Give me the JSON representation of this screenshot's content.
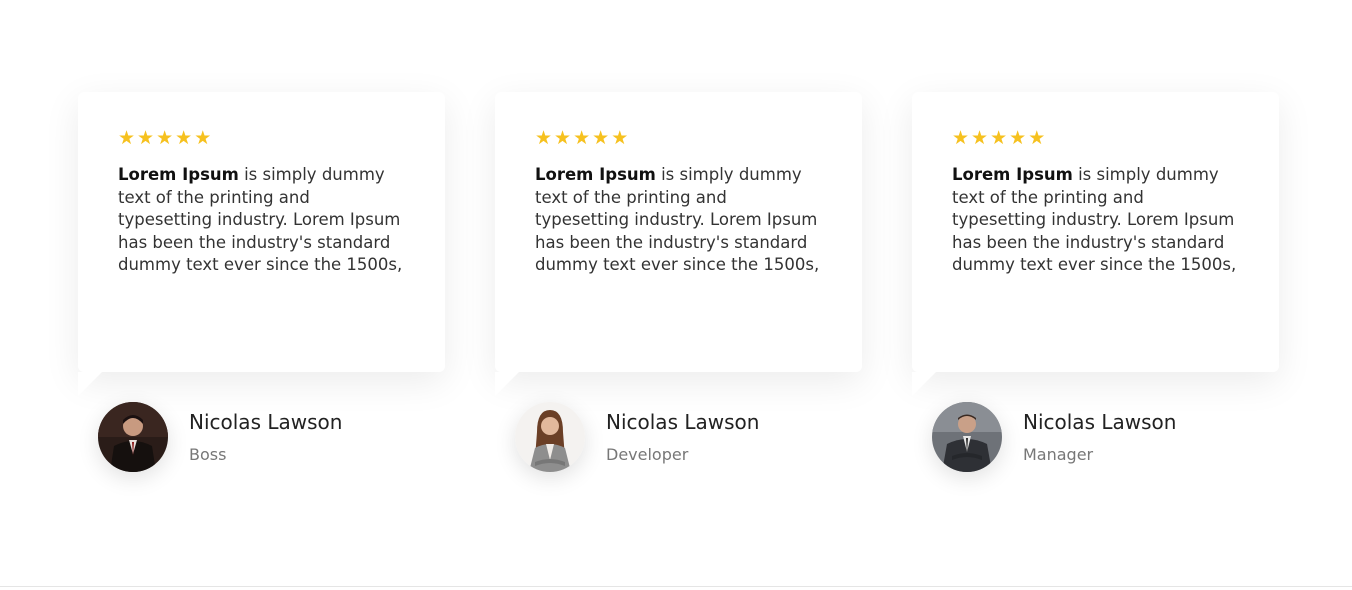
{
  "testimonials": [
    {
      "rating": 5,
      "quote_strong": "Lorem Ipsum",
      "quote_rest": " is simply dummy text of the printing and typesetting industry. Lorem Ipsum has been the industry's standard dummy text ever since the 1500s,",
      "name": "Nicolas Lawson",
      "role": "Boss"
    },
    {
      "rating": 5,
      "quote_strong": "Lorem Ipsum",
      "quote_rest": " is simply dummy text of the printing and typesetting industry. Lorem Ipsum has been the industry's standard dummy text ever since the 1500s,",
      "name": "Nicolas Lawson",
      "role": "Developer"
    },
    {
      "rating": 5,
      "quote_strong": "Lorem Ipsum",
      "quote_rest": " is simply dummy text of the printing and typesetting industry. Lorem Ipsum has been the industry's standard dummy text ever since the 1500s,",
      "name": "Nicolas Lawson",
      "role": "Manager"
    }
  ],
  "icons": {
    "star": "star-icon"
  },
  "colors": {
    "star": "#f6c11f",
    "text": "#333333",
    "name": "#222222",
    "role": "#777777",
    "background": "#ffffff"
  }
}
